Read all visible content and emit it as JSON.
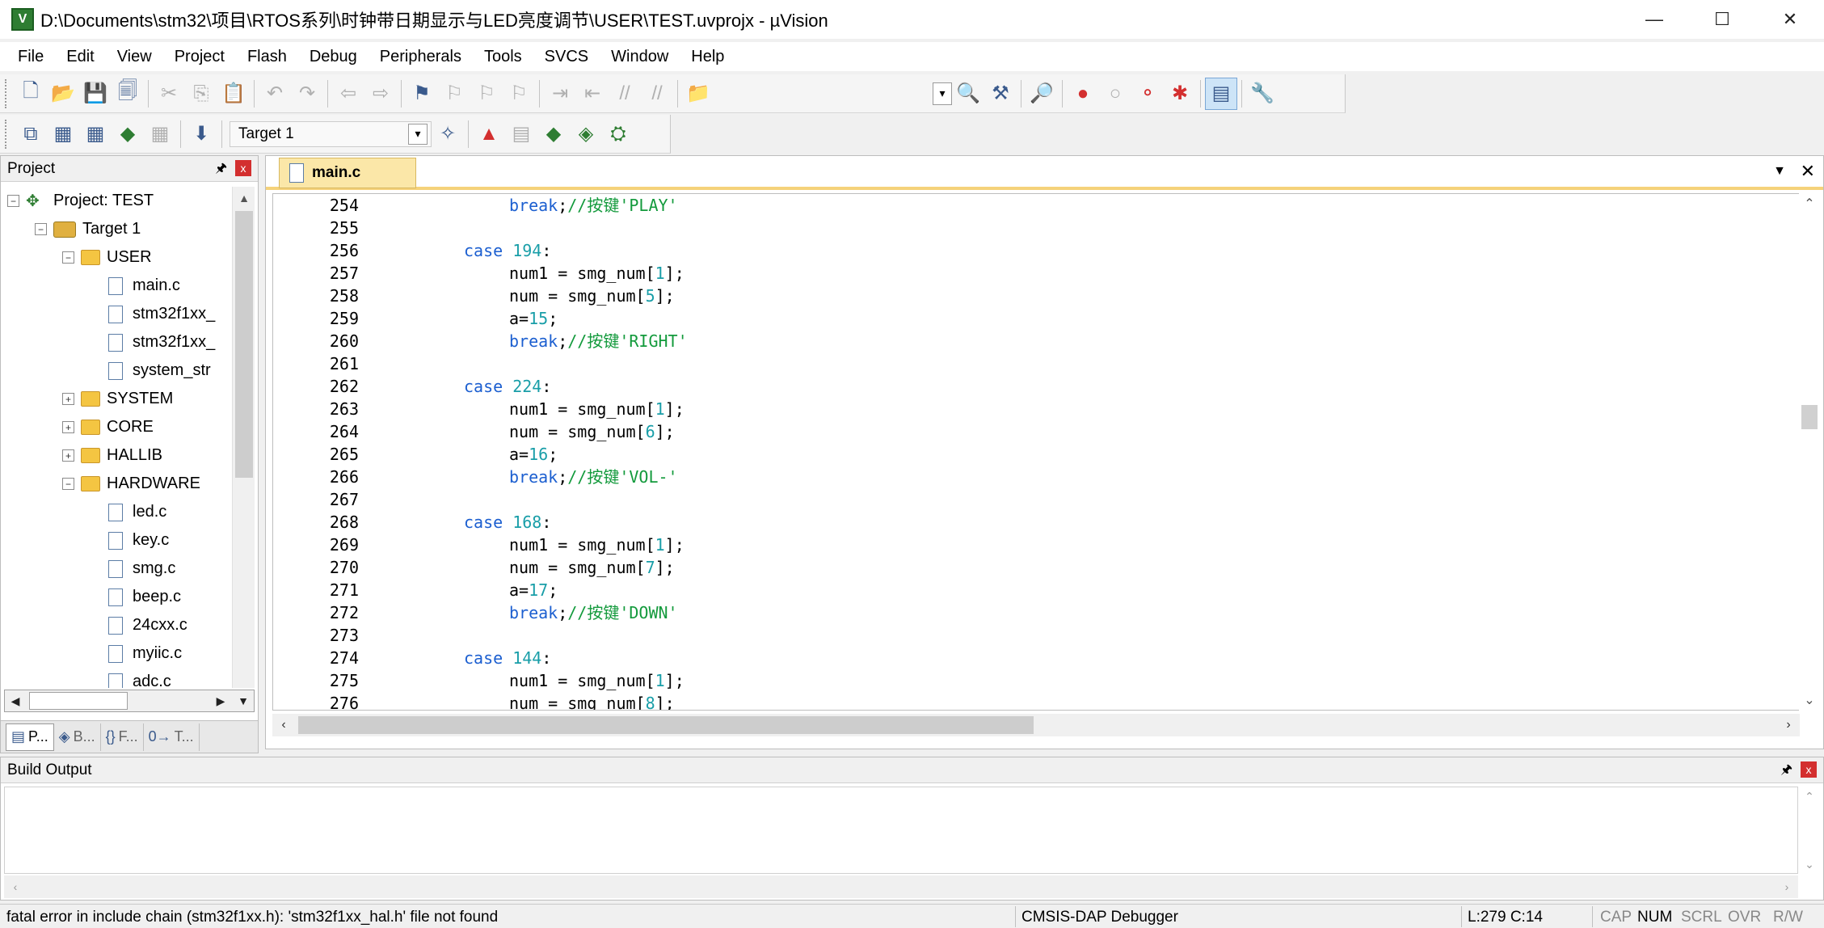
{
  "window": {
    "title": "D:\\Documents\\stm32\\项目\\RTOS系列\\时钟带日期显示与LED亮度调节\\USER\\TEST.uvprojx - µVision",
    "icon_label": "V",
    "minimize": "—",
    "maximize": "☐",
    "close": "✕"
  },
  "menu": [
    "File",
    "Edit",
    "View",
    "Project",
    "Flash",
    "Debug",
    "Peripherals",
    "Tools",
    "SVCS",
    "Window",
    "Help"
  ],
  "toolbar2": {
    "target": "Target 1"
  },
  "project_panel": {
    "title": "Project",
    "pin": "🖈",
    "close": "x",
    "tree": [
      {
        "level": 0,
        "expander": "−",
        "icon": "project",
        "label": "Project: TEST"
      },
      {
        "level": 1,
        "expander": "−",
        "icon": "target",
        "label": "Target 1"
      },
      {
        "level": 2,
        "expander": "−",
        "icon": "folder",
        "label": "USER"
      },
      {
        "level": 3,
        "expander": "",
        "icon": "file",
        "label": "main.c"
      },
      {
        "level": 3,
        "expander": "",
        "icon": "file",
        "label": "stm32f1xx_"
      },
      {
        "level": 3,
        "expander": "",
        "icon": "file",
        "label": "stm32f1xx_"
      },
      {
        "level": 3,
        "expander": "",
        "icon": "file",
        "label": "system_str"
      },
      {
        "level": 2,
        "expander": "+",
        "icon": "folder",
        "label": "SYSTEM"
      },
      {
        "level": 2,
        "expander": "+",
        "icon": "folder",
        "label": "CORE"
      },
      {
        "level": 2,
        "expander": "+",
        "icon": "folder",
        "label": "HALLIB"
      },
      {
        "level": 2,
        "expander": "−",
        "icon": "folder",
        "label": "HARDWARE"
      },
      {
        "level": 3,
        "expander": "",
        "icon": "file",
        "label": "led.c"
      },
      {
        "level": 3,
        "expander": "",
        "icon": "file",
        "label": "key.c"
      },
      {
        "level": 3,
        "expander": "",
        "icon": "file",
        "label": "smg.c"
      },
      {
        "level": 3,
        "expander": "",
        "icon": "file",
        "label": "beep.c"
      },
      {
        "level": 3,
        "expander": "",
        "icon": "file",
        "label": "24cxx.c"
      },
      {
        "level": 3,
        "expander": "",
        "icon": "file",
        "label": "myiic.c"
      },
      {
        "level": 3,
        "expander": "",
        "icon": "file",
        "label": "adc.c"
      }
    ],
    "tabs": [
      {
        "icon": "▤",
        "label": "P..."
      },
      {
        "icon": "◈",
        "label": "B..."
      },
      {
        "icon": "{}",
        "label": "F..."
      },
      {
        "icon": "0→",
        "label": "T..."
      }
    ]
  },
  "editor": {
    "tab": "main.c",
    "tab_dropdown": "▼",
    "tab_close": "✕",
    "lines": [
      {
        "n": "254",
        "tokens": [
          [
            "kw",
            "break"
          ],
          [
            "",
            ";"
          ],
          [
            "cmt",
            "//按键'PLAY'"
          ]
        ]
      },
      {
        "n": "255",
        "tokens": []
      },
      {
        "n": "256",
        "tokens": [
          [
            "kw",
            "case "
          ],
          [
            "num",
            "194"
          ],
          [
            "",
            ":"
          ]
        ]
      },
      {
        "n": "257",
        "tokens": [
          [
            "",
            "num1 = smg_num["
          ],
          [
            "num",
            "1"
          ],
          [
            "",
            "];"
          ]
        ]
      },
      {
        "n": "258",
        "tokens": [
          [
            "",
            "num = smg_num["
          ],
          [
            "num",
            "5"
          ],
          [
            "",
            "];"
          ]
        ]
      },
      {
        "n": "259",
        "tokens": [
          [
            "",
            "a="
          ],
          [
            "num",
            "15"
          ],
          [
            "",
            ";"
          ]
        ]
      },
      {
        "n": "260",
        "tokens": [
          [
            "kw",
            "break"
          ],
          [
            "",
            ";"
          ],
          [
            "cmt",
            "//按键'RIGHT'"
          ]
        ]
      },
      {
        "n": "261",
        "tokens": []
      },
      {
        "n": "262",
        "tokens": [
          [
            "kw",
            "case "
          ],
          [
            "num",
            "224"
          ],
          [
            "",
            ":"
          ]
        ]
      },
      {
        "n": "263",
        "tokens": [
          [
            "",
            "num1 = smg_num["
          ],
          [
            "num",
            "1"
          ],
          [
            "",
            "];"
          ]
        ]
      },
      {
        "n": "264",
        "tokens": [
          [
            "",
            "num = smg_num["
          ],
          [
            "num",
            "6"
          ],
          [
            "",
            "];"
          ]
        ]
      },
      {
        "n": "265",
        "tokens": [
          [
            "",
            "a="
          ],
          [
            "num",
            "16"
          ],
          [
            "",
            ";"
          ]
        ]
      },
      {
        "n": "266",
        "tokens": [
          [
            "kw",
            "break"
          ],
          [
            "",
            ";"
          ],
          [
            "cmt",
            "//按键'VOL-'"
          ]
        ]
      },
      {
        "n": "267",
        "tokens": []
      },
      {
        "n": "268",
        "tokens": [
          [
            "kw",
            "case "
          ],
          [
            "num",
            "168"
          ],
          [
            "",
            ":"
          ]
        ]
      },
      {
        "n": "269",
        "tokens": [
          [
            "",
            "num1 = smg_num["
          ],
          [
            "num",
            "1"
          ],
          [
            "",
            "];"
          ]
        ]
      },
      {
        "n": "270",
        "tokens": [
          [
            "",
            "num = smg_num["
          ],
          [
            "num",
            "7"
          ],
          [
            "",
            "];"
          ]
        ]
      },
      {
        "n": "271",
        "tokens": [
          [
            "",
            "a="
          ],
          [
            "num",
            "17"
          ],
          [
            "",
            ";"
          ]
        ]
      },
      {
        "n": "272",
        "tokens": [
          [
            "kw",
            "break"
          ],
          [
            "",
            ";"
          ],
          [
            "cmt",
            "//按键'DOWN'"
          ]
        ]
      },
      {
        "n": "273",
        "tokens": []
      },
      {
        "n": "274",
        "tokens": [
          [
            "kw",
            "case "
          ],
          [
            "num",
            "144"
          ],
          [
            "",
            ":"
          ]
        ]
      },
      {
        "n": "275",
        "tokens": [
          [
            "",
            "num1 = smg_num["
          ],
          [
            "num",
            "1"
          ],
          [
            "",
            "];"
          ]
        ]
      },
      {
        "n": "276",
        "tokens": [
          [
            "",
            "num = smg_num["
          ],
          [
            "num",
            "8"
          ],
          [
            "",
            "];"
          ]
        ]
      }
    ],
    "indent": [
      2,
      0,
      1,
      2,
      2,
      2,
      2,
      0,
      1,
      2,
      2,
      2,
      2,
      0,
      1,
      2,
      2,
      2,
      2,
      0,
      1,
      2,
      2
    ]
  },
  "build_output": {
    "title": "Build Output",
    "pin": "🖈",
    "close": "x",
    "content": ""
  },
  "status": {
    "message": "fatal error in include chain (stm32f1xx.h): 'stm32f1xx_hal.h' file not found",
    "debugger": "CMSIS-DAP Debugger",
    "position": "L:279 C:14",
    "cap": "CAP",
    "num": "NUM",
    "scrl": "SCRL",
    "ovr": "OVR",
    "rw": "R/W"
  },
  "colors": {
    "keyword": "#1c5fd0",
    "number": "#199ea8",
    "comment": "#139a3c",
    "tab_active": "#fbe7a8"
  }
}
